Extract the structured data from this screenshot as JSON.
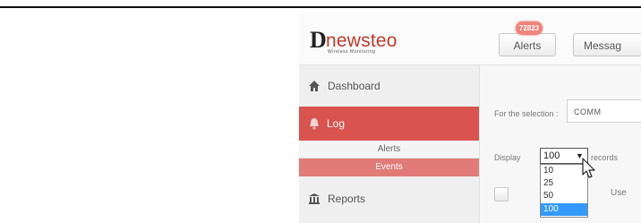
{
  "logo": {
    "mark": "D",
    "name": "newsteo",
    "tagline": "Wireless Monitoring"
  },
  "header": {
    "alerts_label": "Alerts",
    "alerts_badge": "72823",
    "messages_label": "Messag"
  },
  "sidebar": {
    "items": [
      {
        "label": "Dashboard",
        "icon": "home-icon"
      },
      {
        "label": "Log",
        "icon": "bell-icon"
      },
      {
        "label": "Alerts"
      },
      {
        "label": "Events"
      },
      {
        "label": "Reports",
        "icon": "bank-icon"
      }
    ]
  },
  "main": {
    "selection_label": "For the selection :",
    "selection_button": "COMM",
    "display_label": "Display",
    "page_size_value": "100",
    "records_label": "records",
    "page_size_options": [
      "10",
      "25",
      "50",
      "100"
    ],
    "user_column": "Use"
  },
  "colors": {
    "accent": "#d9534f",
    "accent_light": "#e07b78",
    "selected_option": "#3399ff"
  }
}
